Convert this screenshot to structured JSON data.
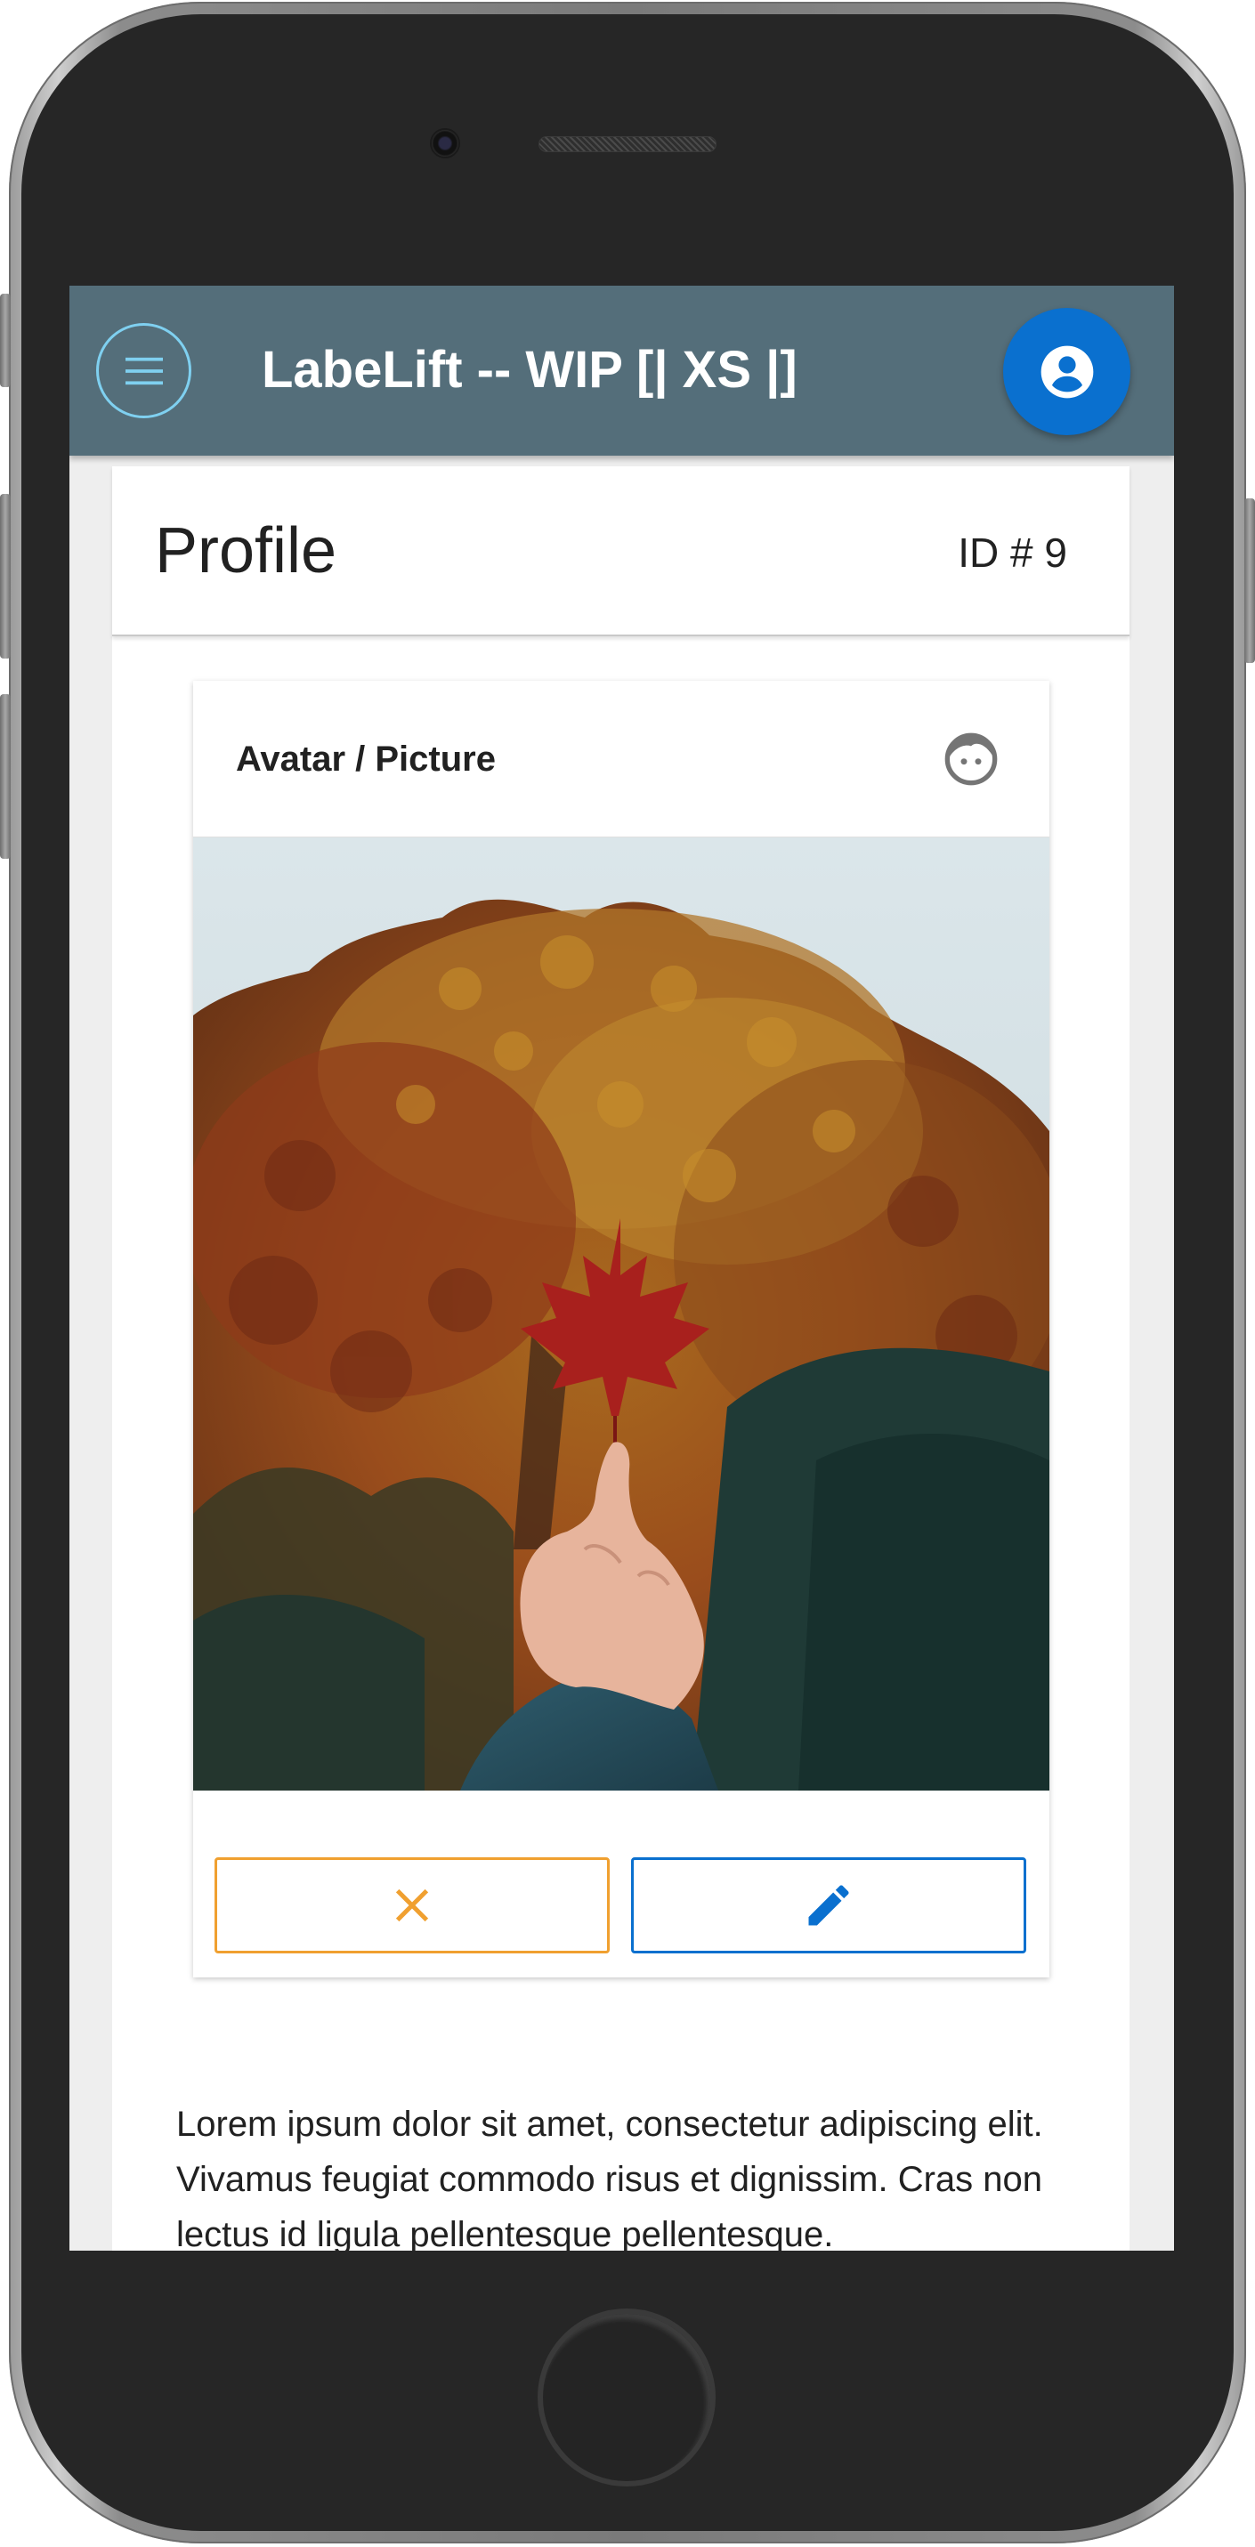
{
  "toolbar": {
    "menu_icon": "menu-icon",
    "title": "LabeLift -- WIP [| XS |]",
    "account_icon": "account-circle-icon",
    "color": "#546e7a",
    "account_color": "#0a70cf"
  },
  "profile": {
    "title": "Profile",
    "id_label": "ID # 9"
  },
  "avatar_card": {
    "label": "Avatar / Picture",
    "header_icon": "face-icon",
    "picture": "autumn-tree-with-red-maple-leaf",
    "clear_icon": "close-icon",
    "clear_color": "#f0a030",
    "edit_icon": "pencil-icon",
    "edit_color": "#0a70cf"
  },
  "body_text": "Lorem ipsum dolor sit amet, consectetur adipiscing elit. Vivamus feugiat commodo risus et dignissim. Cras non lectus id ligula pellentesque pellentesque."
}
